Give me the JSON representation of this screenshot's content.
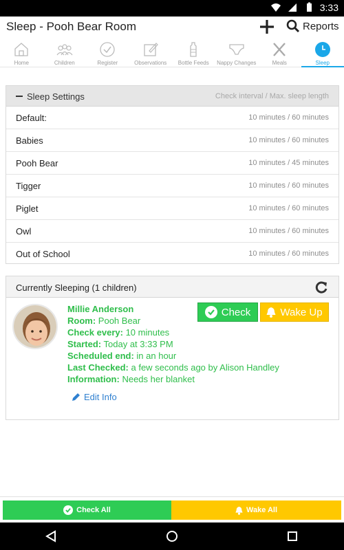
{
  "status": {
    "time": "3:33"
  },
  "appbar": {
    "title": "Sleep - Pooh Bear Room",
    "reports_label": "Reports"
  },
  "tabs": [
    {
      "label": "Home"
    },
    {
      "label": "Children"
    },
    {
      "label": "Register"
    },
    {
      "label": "Observations"
    },
    {
      "label": "Bottle Feeds"
    },
    {
      "label": "Nappy Changes"
    },
    {
      "label": "Meals"
    },
    {
      "label": "Sleep"
    }
  ],
  "settings": {
    "title": "Sleep Settings",
    "hint": "Check interval / Max. sleep length",
    "rows": [
      {
        "name": "Default:",
        "value": "10 minutes / 60 minutes"
      },
      {
        "name": "Babies",
        "value": "10 minutes / 60 minutes"
      },
      {
        "name": "Pooh Bear",
        "value": "10 minutes / 45 minutes"
      },
      {
        "name": "Tigger",
        "value": "10 minutes / 60 minutes"
      },
      {
        "name": "Piglet",
        "value": "10 minutes / 60 minutes"
      },
      {
        "name": "Owl",
        "value": "10 minutes / 60 minutes"
      },
      {
        "name": "Out of School",
        "value": "10 minutes / 60 minutes"
      }
    ]
  },
  "sleeping": {
    "title": "Currently Sleeping (1 children)",
    "child": {
      "name": "Millie Anderson",
      "room_label": "Room:",
      "room": "Pooh Bear",
      "check_label": "Check every:",
      "check": "10 minutes",
      "started_label": "Started:",
      "started": "Today at 3:33 PM",
      "end_label": "Scheduled end:",
      "end": "in an hour",
      "last_label": "Last Checked:",
      "last": "a few seconds ago by Alison Handley",
      "info_label": "Information:",
      "info": "Needs her blanket"
    },
    "check_button": "Check",
    "wake_button": "Wake Up",
    "edit_label": "Edit Info"
  },
  "bottom": {
    "check_all": "Check All",
    "wake_all": "Wake All"
  },
  "colors": {
    "green": "#2ecc55",
    "yellow": "#ffc800",
    "accent": "#1aa7e8",
    "text_green": "#2fbe4b",
    "link": "#2f80d0"
  }
}
